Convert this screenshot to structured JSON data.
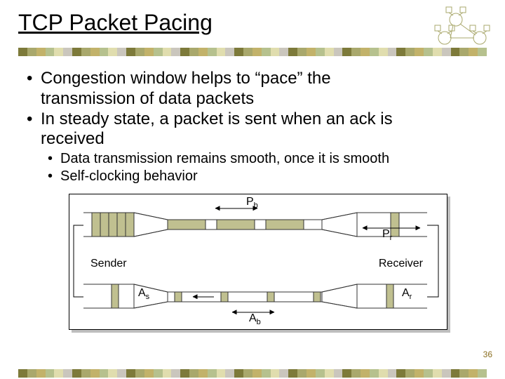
{
  "title": "TCP Packet Pacing",
  "bullets1": {
    "b1a": "Congestion window helps to “pace” the",
    "b1b": "transmission of data packets",
    "b2a": "In steady state, a packet is sent when an ack is",
    "b2b": "received"
  },
  "bullets2": {
    "s1": "Data transmission remains smooth, once it is smooth",
    "s2": "Self-clocking behavior"
  },
  "diagram": {
    "pb": "P",
    "pb_sub": "b",
    "pr": "P",
    "pr_sub": "r",
    "as": "A",
    "as_sub": "s",
    "ab": "A",
    "ab_sub": "b",
    "ar": "A",
    "ar_sub": "r",
    "sender": "Sender",
    "receiver": "Receiver"
  },
  "page_number": "36",
  "colors": {
    "olive": "#a9a86c",
    "dkolive": "#7d7a3a",
    "tan": "#c2b26a",
    "sage": "#b6c18e",
    "cream": "#e0ddae",
    "gray": "#cac6bd"
  }
}
